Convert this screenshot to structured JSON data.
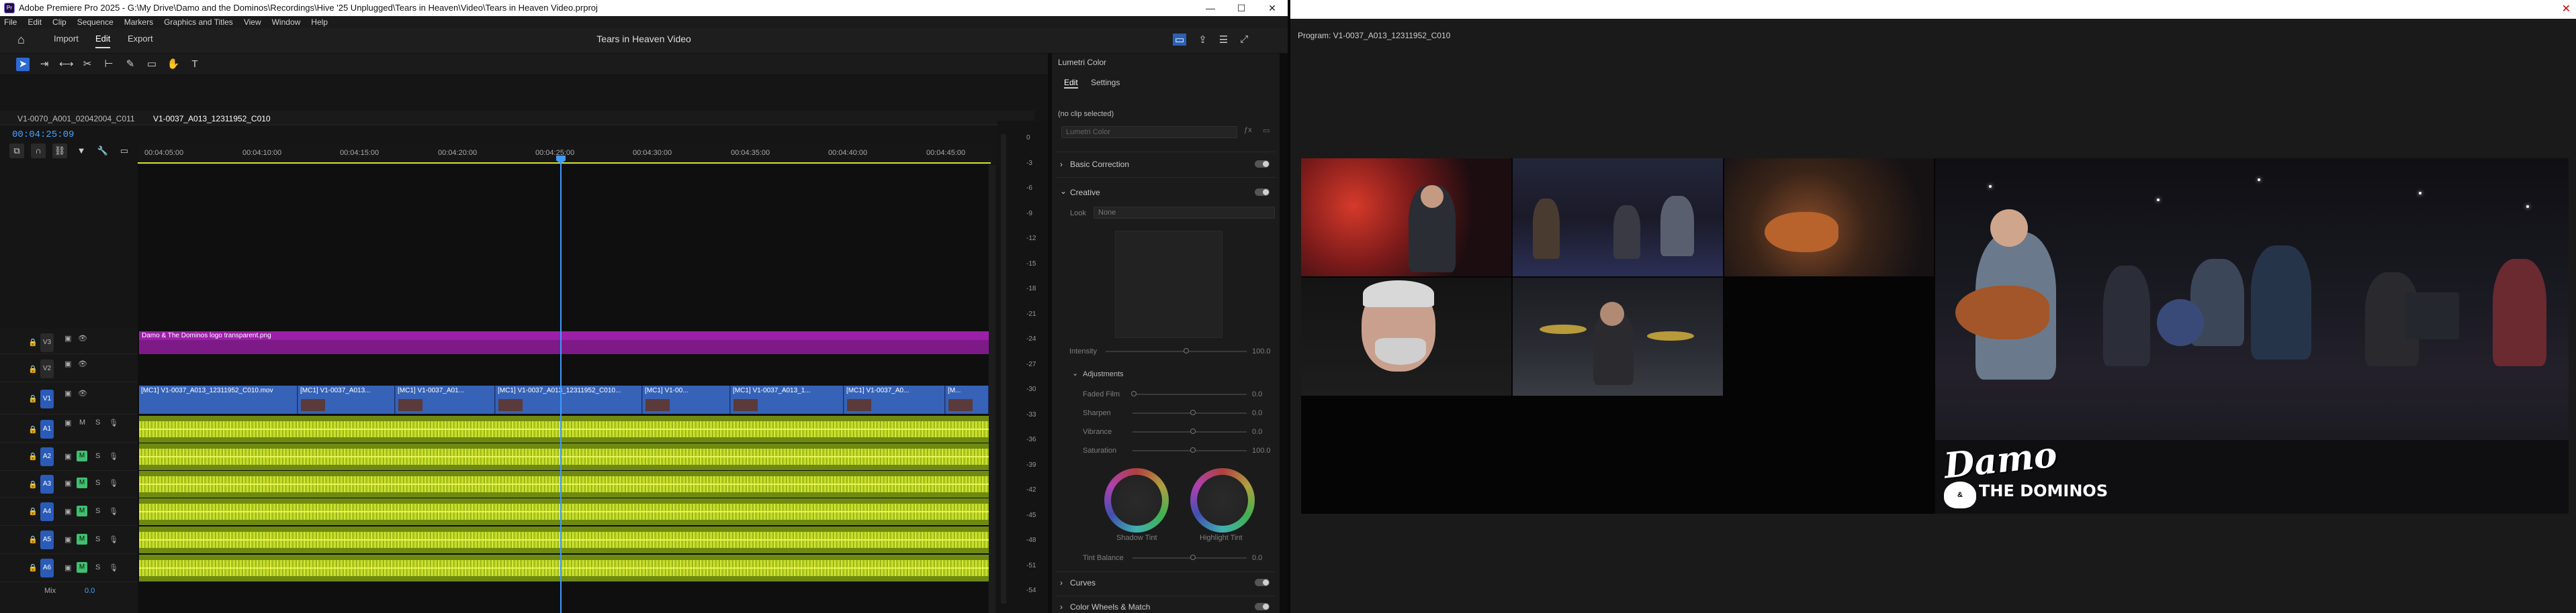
{
  "app": {
    "title": "Adobe Premiere Pro 2025 - G:\\My Drive\\Damo and the Dominos\\Recordings\\Hive '25 Unplugged\\Tears in Heaven\\Video\\Tears in Heaven Video.prproj",
    "logo_text": "Pr",
    "menu": [
      "File",
      "Edit",
      "Clip",
      "Sequence",
      "Markers",
      "Graphics and Titles",
      "View",
      "Window",
      "Help"
    ],
    "window_buttons": {
      "minimize": "—",
      "maximize": "☐",
      "close": "✕"
    }
  },
  "workspace": {
    "tabs": [
      "Import",
      "Edit",
      "Export"
    ],
    "active_tab": "Edit",
    "project_title": "Tears in Heaven Video"
  },
  "timeline": {
    "sequence_tabs": [
      "V1-0070_A001_02042004_C011",
      "V1-0037_A013_12311952_C010"
    ],
    "active_sequence": "V1-0037_A013_12311952_C010",
    "timecode": "00:04:25:09",
    "ruler_ticks": [
      "00:04:05:00",
      "00:04:10:00",
      "00:04:15:00",
      "00:04:20:00",
      "00:04:25:00",
      "00:04:30:00",
      "00:04:35:00",
      "00:04:40:00",
      "00:04:45:00"
    ],
    "video_tracks": [
      "V3",
      "V2",
      "V1"
    ],
    "audio_tracks": [
      "A1",
      "A2",
      "A3",
      "A4",
      "A5",
      "A6"
    ],
    "mix_label": "Mix",
    "mix_value": "0.0",
    "track_toggles": {
      "mute": "M",
      "solo": "S"
    },
    "v3_clip": "Damo & The Dominos logo transparent.png",
    "v1_clips": [
      "[MC1] V1-0037_A013_12311952_C010.mov",
      "[MC1] V1-0037_A013...",
      "[MC1] V1-0037_A01...",
      "[MC1] V1-0037_A013_12311952_C010...",
      "[MC1] V1-00...",
      "[MC1] V1-0037_A013_1...",
      "[MC1] V1-0037_A0...",
      "[M..."
    ],
    "meter_scale": [
      "0",
      "-3",
      "-6",
      "-9",
      "-12",
      "-15",
      "-18",
      "-21",
      "-24",
      "-27",
      "-30",
      "-33",
      "-36",
      "-39",
      "-42",
      "-45",
      "-48",
      "-51",
      "-54"
    ]
  },
  "lumetri": {
    "panel_title": "Lumetri Color",
    "tabs": [
      "Edit",
      "Settings"
    ],
    "no_clip": "(no clip selected)",
    "preset_placeholder": "Lumetri Color",
    "sections": {
      "basic": "Basic Correction",
      "creative": "Creative",
      "curves": "Curves",
      "wheels": "Color Wheels & Match"
    },
    "look_label": "Look",
    "look_value": "None",
    "intensity_label": "Intensity",
    "intensity_value": "100.0",
    "adjustments_label": "Adjustments",
    "sliders": [
      {
        "label": "Faded Film",
        "value": "0.0"
      },
      {
        "label": "Sharpen",
        "value": "0.0"
      },
      {
        "label": "Vibrance",
        "value": "0.0"
      },
      {
        "label": "Saturation",
        "value": "100.0"
      }
    ],
    "wheels": [
      "Shadow Tint",
      "Highlight Tint"
    ],
    "tint_balance_label": "Tint Balance",
    "tint_balance_value": "0.0"
  },
  "program": {
    "label": "Program: V1-0037_A013_12311952_C010",
    "logo_line1": "Damo",
    "logo_amp": "&",
    "logo_line2": "THE DOMINOS"
  },
  "colors": {
    "accent_blue": "#2c6ad1",
    "playhead": "#3d9bff",
    "audio_clip": "#c6dd2a",
    "logo_clip": "#9b1fa8",
    "multicam_select": "#e6d320"
  }
}
